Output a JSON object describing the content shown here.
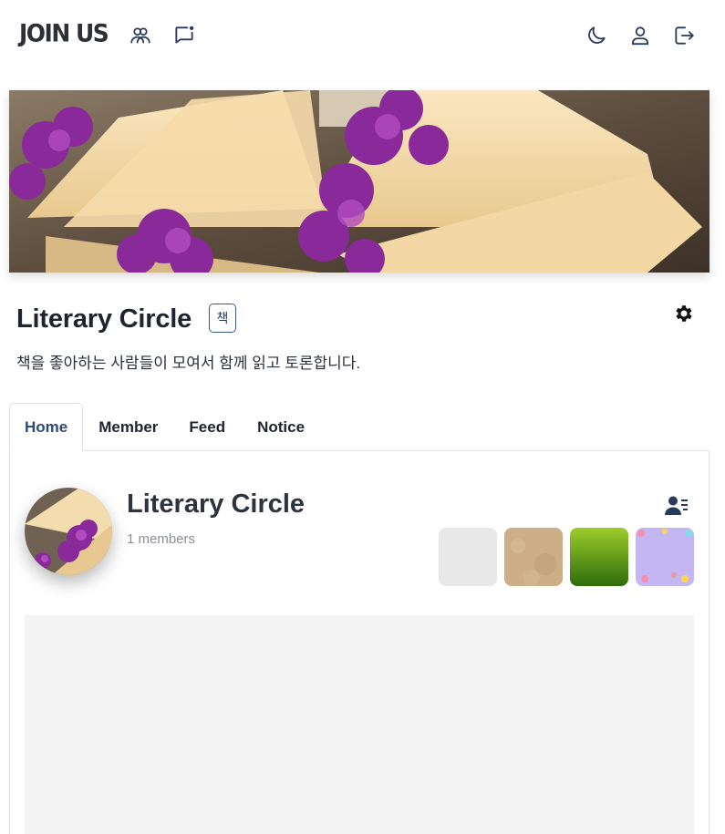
{
  "header": {
    "logo": "JOIN US",
    "icons": {
      "groups": "groups-icon",
      "chat": "chat-notification-icon",
      "theme": "moon-icon",
      "profile": "user-icon",
      "logout": "logout-icon"
    }
  },
  "group": {
    "name": "Literary Circle",
    "category": "책",
    "description": "책을 좋아하는 사람들이 모여서 함께 읽고 토론합니다."
  },
  "tabs": [
    {
      "label": "Home",
      "active": true
    },
    {
      "label": "Member",
      "active": false
    },
    {
      "label": "Feed",
      "active": false
    },
    {
      "label": "Notice",
      "active": false
    }
  ],
  "home": {
    "title": "Literary Circle",
    "member_count": "1 members"
  },
  "colors": {
    "accent": "#2d4a7a",
    "badge_border": "#3b5a8c",
    "muted_text": "#8a8f98"
  }
}
